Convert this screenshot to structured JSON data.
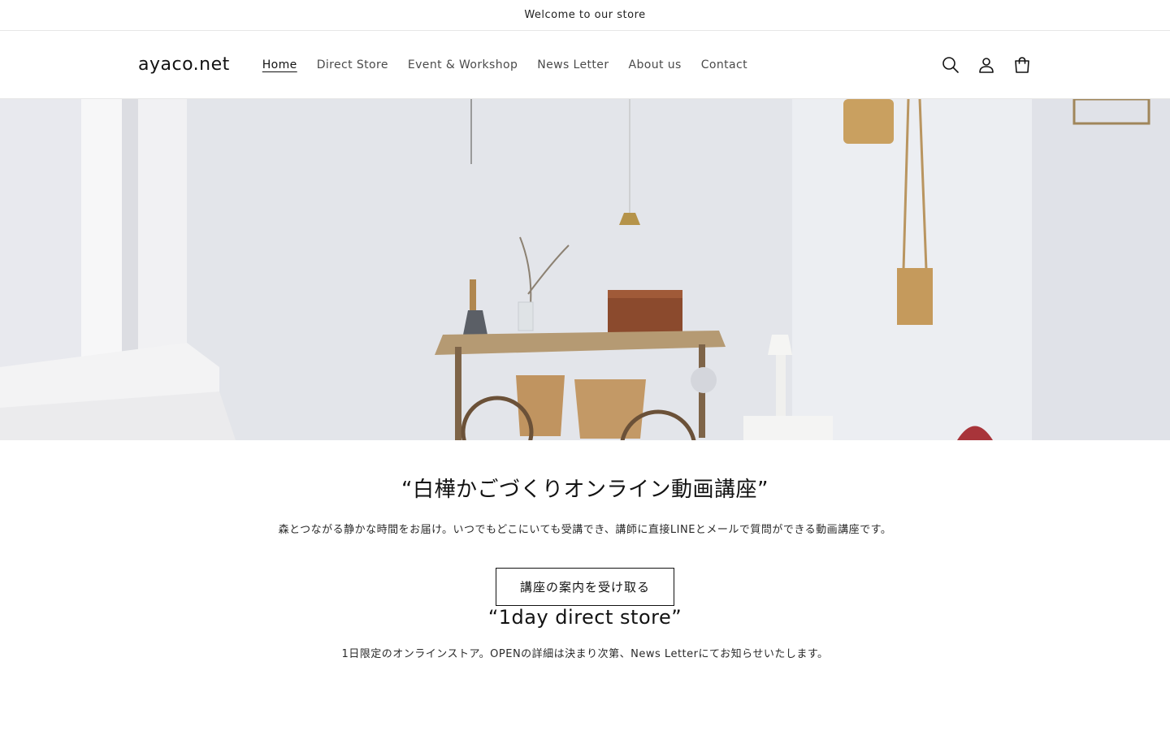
{
  "announcement": {
    "text": "Welcome to our store"
  },
  "header": {
    "logo": "ayaco.net",
    "nav": [
      {
        "label": "Home",
        "active": true
      },
      {
        "label": "Direct Store",
        "active": false
      },
      {
        "label": "Event & Workshop",
        "active": false
      },
      {
        "label": "News Letter",
        "active": false
      },
      {
        "label": "About us",
        "active": false
      },
      {
        "label": "Contact",
        "active": false
      }
    ],
    "icons": [
      "search-icon",
      "account-icon",
      "cart-icon"
    ]
  },
  "hero": {
    "image": "interior-photo-with-birch-baskets-cart-and-pendant-lamp"
  },
  "course": {
    "title": "“白樺かごづくりオンライン動画講座”",
    "description": "森とつながる静かな時間をお届け。いつでもどこにいても受講でき、講師に直接LINEとメールで質問ができる動画講座です。",
    "button_label": "講座の案内を受け取る"
  },
  "store": {
    "title": "“1day direct store”",
    "description": "1日限定のオンラインストア。OPENの詳細は決まり次第、News Letterにてお知らせいたします。"
  },
  "colors": {
    "text": "#121212",
    "nav_text": "#4a4a4a",
    "border": "#e6e6e6",
    "background": "#ffffff"
  }
}
